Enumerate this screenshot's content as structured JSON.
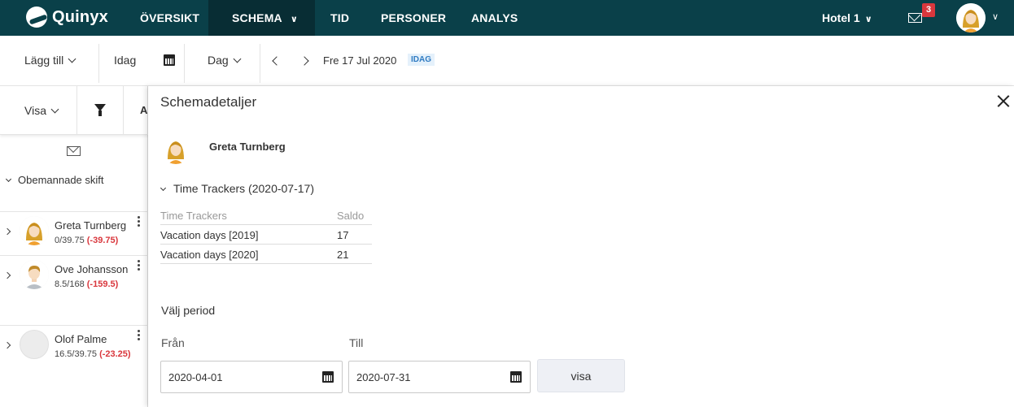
{
  "brand": "Quinyx",
  "nav": {
    "oversikt": "ÖVERSIKT",
    "schema": "SCHEMA",
    "tid": "TID",
    "personer": "PERSONER",
    "analys": "ANALYS",
    "unit": "Hotel 1",
    "mail_badge": "3"
  },
  "toolbar": {
    "add": "Lägg till",
    "today": "Idag",
    "view_mode": "Dag",
    "date": "Fre 17 Jul 2020",
    "today_badge": "IDAG"
  },
  "sidebar": {
    "show": "Visa",
    "sort_icon_text": "A",
    "unmanned": "Obemannade skift",
    "people": [
      {
        "name": "Greta Turnberg",
        "hours": "0/39.75",
        "diff": "(-39.75)"
      },
      {
        "name": "Ove Johansson",
        "hours": "8.5/168",
        "diff": "(-159.5)"
      },
      {
        "name": "Olof Palme",
        "hours": "16.5/39.75",
        "diff": "(-23.25)"
      }
    ]
  },
  "panel": {
    "title": "Schemadetaljer",
    "employee": "Greta Turnberg",
    "tt_header": "Time Trackers (2020-07-17)",
    "tt_columns": [
      "Time Trackers",
      "Saldo"
    ],
    "tt_rows": [
      {
        "name": "Vacation days [2019]",
        "saldo": "17"
      },
      {
        "name": "Vacation days [2020]",
        "saldo": "21"
      }
    ],
    "period_label": "Välj period",
    "from_label": "Från",
    "to_label": "Till",
    "from_value": "2020-04-01",
    "to_value": "2020-07-31",
    "show_button": "visa"
  }
}
